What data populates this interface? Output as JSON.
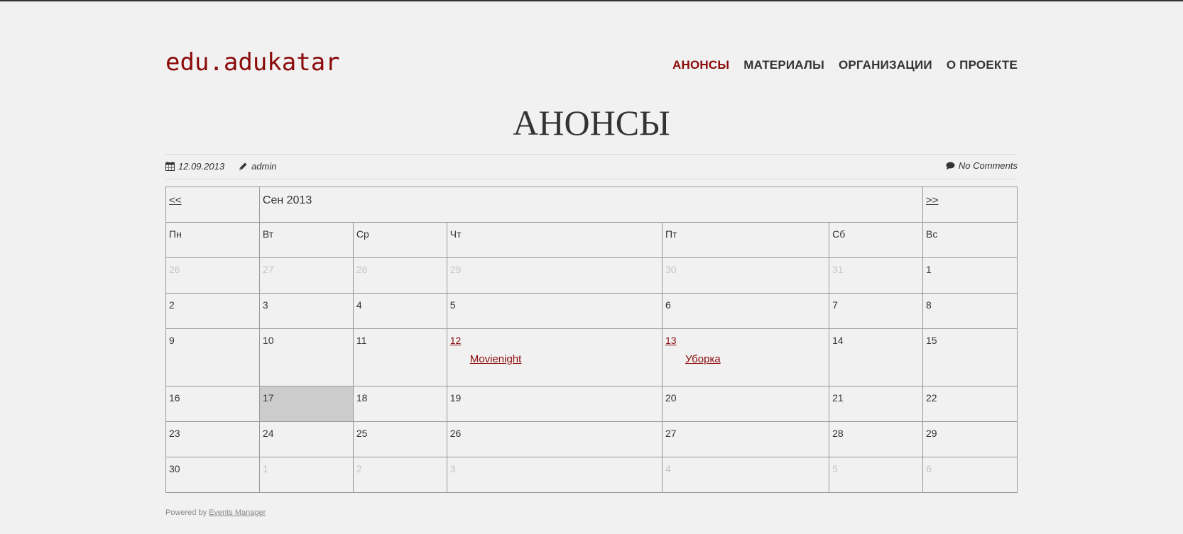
{
  "site": {
    "title": "edu.adukatar"
  },
  "nav": [
    {
      "label": "АНОНСЫ",
      "active": true
    },
    {
      "label": "МАТЕРИАЛЫ",
      "active": false
    },
    {
      "label": "ОРГАНИЗАЦИИ",
      "active": false
    },
    {
      "label": "О ПРОЕКТЕ",
      "active": false
    }
  ],
  "page": {
    "title": "АНОНСЫ"
  },
  "meta": {
    "date": "12.09.2013",
    "author": "admin",
    "comments": "No Comments",
    "icons": {
      "date": "calendar-icon",
      "author": "pencil-icon",
      "comments": "comment-icon"
    }
  },
  "calendar": {
    "prev": "<<",
    "next": ">>",
    "month": "Сен 2013",
    "weekdays": [
      "Пн",
      "Вт",
      "Ср",
      "Чт",
      "Пт",
      "Сб",
      "Вс"
    ],
    "weeks": [
      [
        {
          "d": "26",
          "other": true
        },
        {
          "d": "27",
          "other": true
        },
        {
          "d": "28",
          "other": true
        },
        {
          "d": "29",
          "other": true
        },
        {
          "d": "30",
          "other": true
        },
        {
          "d": "31",
          "other": true
        },
        {
          "d": "1"
        }
      ],
      [
        {
          "d": "2"
        },
        {
          "d": "3"
        },
        {
          "d": "4"
        },
        {
          "d": "5"
        },
        {
          "d": "6"
        },
        {
          "d": "7"
        },
        {
          "d": "8"
        }
      ],
      [
        {
          "d": "9"
        },
        {
          "d": "10"
        },
        {
          "d": "11"
        },
        {
          "d": "12",
          "event": "Movienight"
        },
        {
          "d": "13",
          "event": "Уборка"
        },
        {
          "d": "14"
        },
        {
          "d": "15"
        }
      ],
      [
        {
          "d": "16"
        },
        {
          "d": "17",
          "today": true
        },
        {
          "d": "18"
        },
        {
          "d": "19"
        },
        {
          "d": "20"
        },
        {
          "d": "21"
        },
        {
          "d": "22"
        }
      ],
      [
        {
          "d": "23"
        },
        {
          "d": "24"
        },
        {
          "d": "25"
        },
        {
          "d": "26"
        },
        {
          "d": "27"
        },
        {
          "d": "28"
        },
        {
          "d": "29"
        }
      ],
      [
        {
          "d": "30"
        },
        {
          "d": "1",
          "other": true
        },
        {
          "d": "2",
          "other": true
        },
        {
          "d": "3",
          "other": true
        },
        {
          "d": "4",
          "other": true
        },
        {
          "d": "5",
          "other": true
        },
        {
          "d": "6",
          "other": true
        }
      ]
    ]
  },
  "footer": {
    "prefix": "Powered by",
    "link": "Events Manager"
  },
  "colors": {
    "accent": "#8b0a0a",
    "today_bg": "#cccccc",
    "dim_text": "#c4c4c4"
  }
}
